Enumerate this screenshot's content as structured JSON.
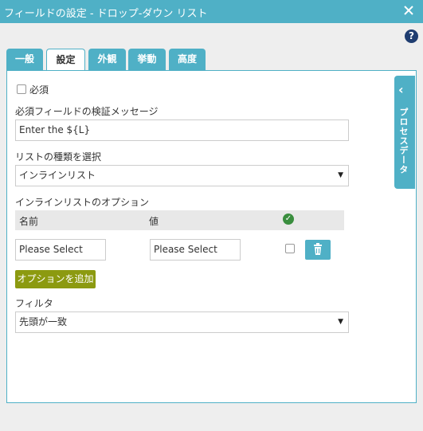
{
  "window": {
    "title": "フィールドの設定 - ドロップ-ダウン リスト"
  },
  "icons": {
    "close": "close-icon",
    "help": "help-icon",
    "trash": "trash-icon",
    "check": "check-circle-icon",
    "chevron": "chevron-left-icon"
  },
  "help": {
    "label": "?"
  },
  "tabs": [
    {
      "label": "一般"
    },
    {
      "label": "設定"
    },
    {
      "label": "外観"
    },
    {
      "label": "挙動"
    },
    {
      "label": "高度"
    }
  ],
  "side_tab": {
    "label": "プロセスデータ"
  },
  "form": {
    "required_label": "必須",
    "validation_label": "必須フィールドの検証メッセージ",
    "validation_value": "Enter the ${L}",
    "list_type_label": "リストの種類を選択",
    "list_type_value": "インラインリスト",
    "inline_options_label": "インラインリストのオプション",
    "grid": {
      "col_name": "名前",
      "col_value": "値",
      "row_name": "Please Select",
      "row_value": "Please Select"
    },
    "add_option_label": "オプションを追加",
    "filter_label": "フィルタ",
    "filter_value": "先頭が一致"
  },
  "colors": {
    "accent": "#4fb0c6",
    "add_button": "#8c9a10",
    "help": "#1f3d70",
    "check": "#3a8e3e"
  }
}
